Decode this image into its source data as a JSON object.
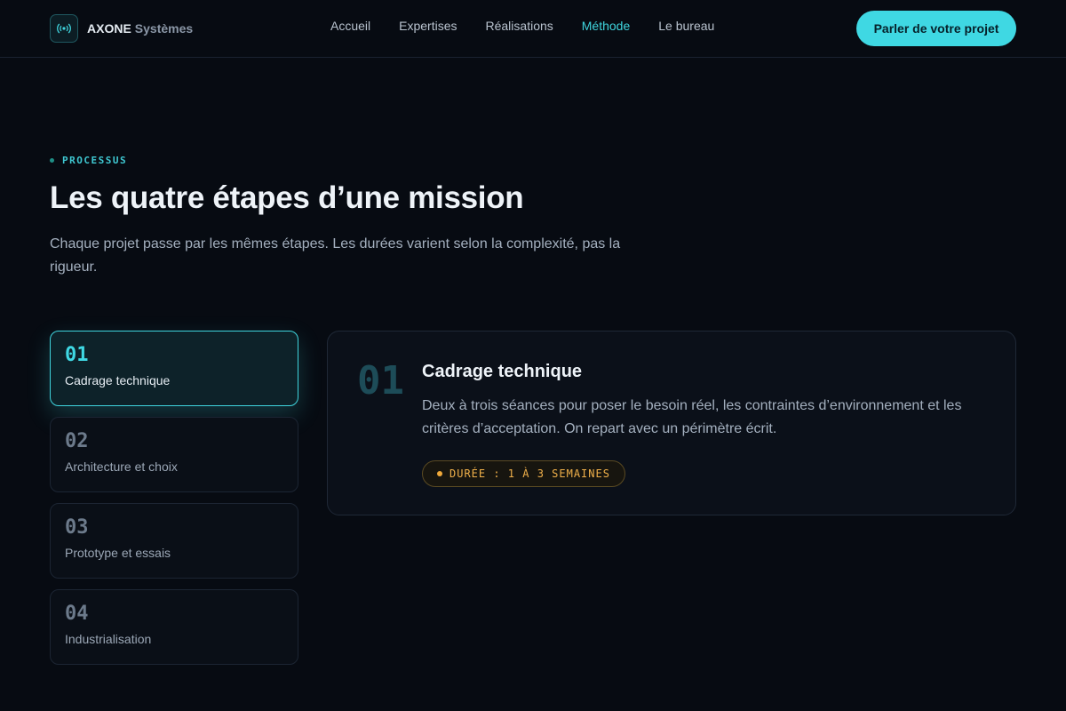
{
  "colors": {
    "background": "#070b12",
    "accent": "#3fd8e3",
    "badge": "#f0b04a"
  },
  "brand": {
    "name": "AXONE",
    "suffix": "Systèmes",
    "logo_icon": "broadcast-icon"
  },
  "nav": {
    "items": [
      {
        "label": "Accueil",
        "active": false
      },
      {
        "label": "Expertises",
        "active": false
      },
      {
        "label": "Réalisations",
        "active": false
      },
      {
        "label": "Méthode",
        "active": true
      },
      {
        "label": "Le bureau",
        "active": false
      }
    ],
    "cta_label": "Parler de votre projet"
  },
  "section": {
    "eyebrow": "PROCESSUS",
    "title": "Les quatre étapes d’une mission",
    "lead": "Chaque projet passe par les mêmes étapes. Les durées varient selon la complexité, pas la rigueur."
  },
  "steps": [
    {
      "number": "01",
      "label": "Cadrage technique",
      "active": true
    },
    {
      "number": "02",
      "label": "Architecture et choix",
      "active": false
    },
    {
      "number": "03",
      "label": "Prototype et essais",
      "active": false
    },
    {
      "number": "04",
      "label": "Industrialisation",
      "active": false
    }
  ],
  "detail": {
    "number": "01",
    "title": "Cadrage technique",
    "description": "Deux à trois séances pour poser le besoin réel, les contraintes d’environnement et les critères d’acceptation. On repart avec un périmètre écrit.",
    "duration": "DURÉE : 1 À 3 SEMAINES"
  }
}
